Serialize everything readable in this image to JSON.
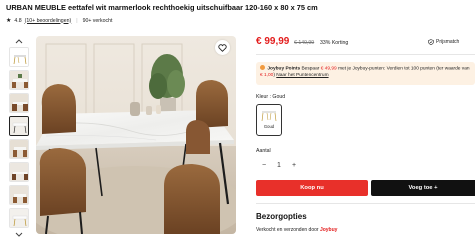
{
  "product": {
    "title": "URBAN MEUBLE eettafel wit marmerlook rechthoekig uitschuifbaar 120-160 x 80 x 75 cm",
    "rating_stars": "★",
    "rating": "4.8",
    "reviews_label": "(10+ beoordelingen)",
    "sold_label": "90+ verkocht",
    "favorite_icon": "heart-icon"
  },
  "pricing": {
    "price": "€ 99,99",
    "old_price": "€ 149,99",
    "discount": "33% Korting",
    "price_guarantee": "Prijsmatch"
  },
  "promo": {
    "brand": "Joybuy Points",
    "text_1": "Bespaar",
    "amount": "€ 49,99",
    "text_2": "met je Joybuy-punten: Verdien tot 100 punten (ter waarde van",
    "amount2": "€ 1,00",
    "text_3": ")",
    "link": "Naar het Puntencentrum"
  },
  "options": {
    "color_label": "Kleur : Goud",
    "color_value": "Goud",
    "quantity_label": "Aantal",
    "quantity": "1",
    "minus": "−",
    "plus": "+"
  },
  "actions": {
    "buy_now": "Koop nu",
    "add_to_cart": "Voeg toe +"
  },
  "delivery": {
    "title": "Bezorgopties",
    "sub_prefix": "Verkocht en verzonden door",
    "sub_brand": "Joybuy"
  },
  "colors": {
    "accent_red": "#e31d1d",
    "buy_button": "#e8302a",
    "add_button": "#111111",
    "promo_bg": "#fdf1e3"
  }
}
